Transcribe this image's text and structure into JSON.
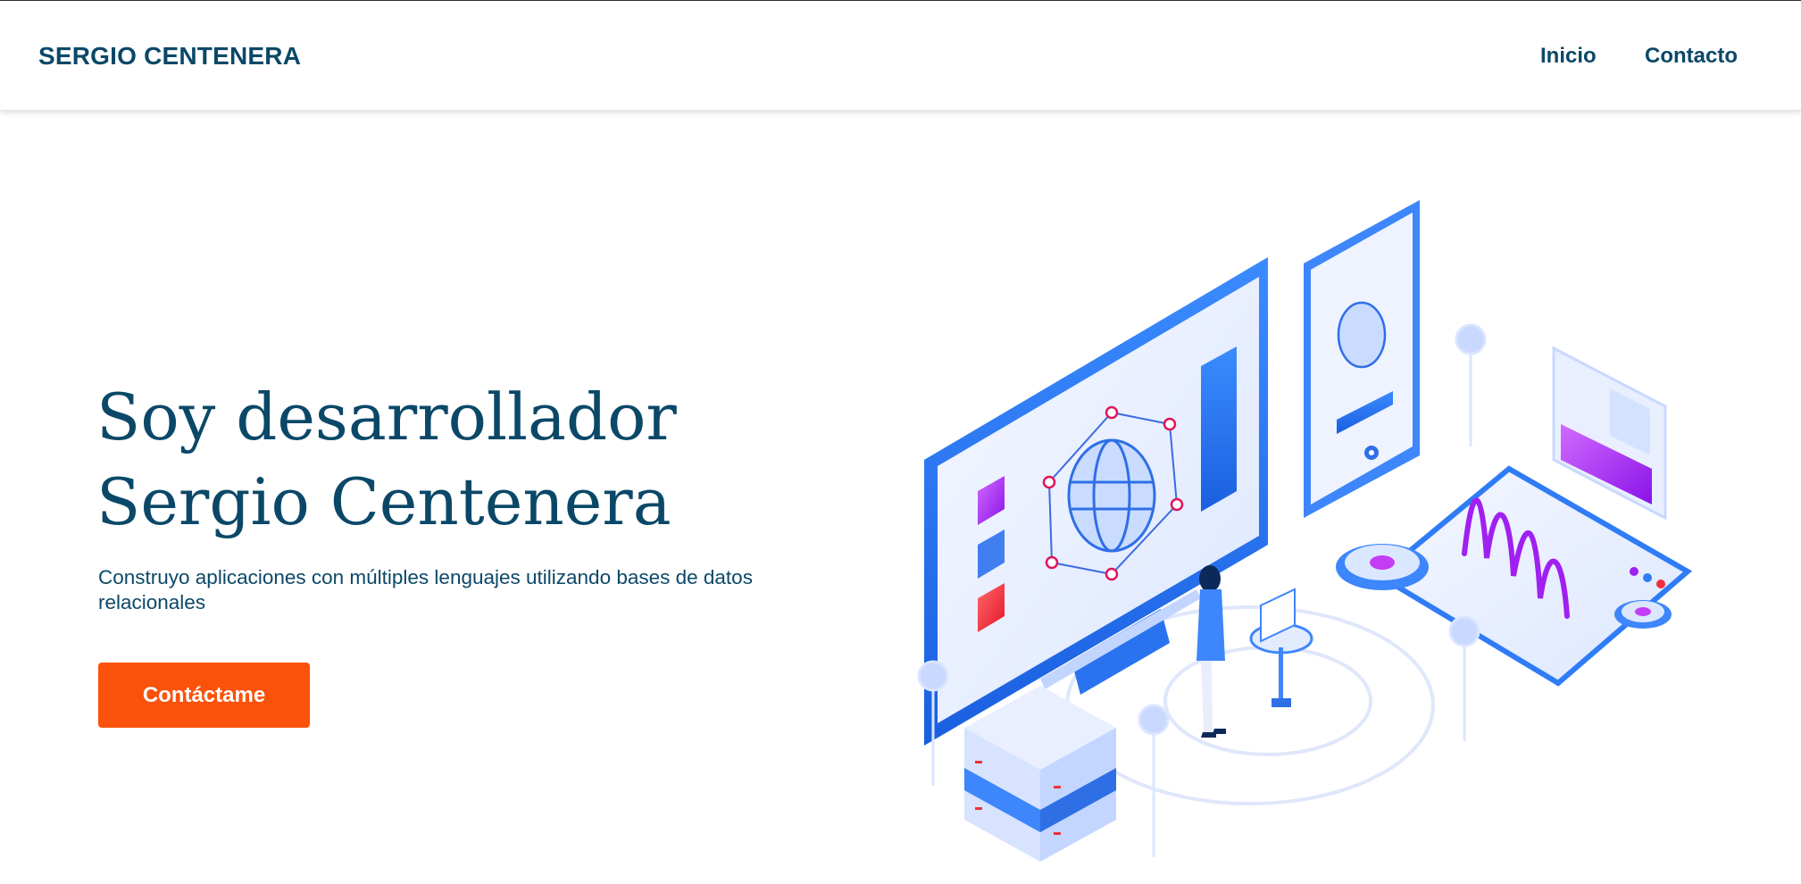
{
  "nav": {
    "brand": "SERGIO CENTENERA",
    "links": [
      {
        "label": "Inicio"
      },
      {
        "label": "Contacto"
      }
    ]
  },
  "hero": {
    "title_lines": [
      "Soy desarrollador",
      "Sergio Centenera"
    ],
    "description": "Construyo aplicaciones con múltiples lenguajes utilizando bases de datos relacionales",
    "cta_label": "Contáctame"
  },
  "colors": {
    "brand_text": "#0b4868",
    "cta": "#fa520a",
    "illustration_blue": "#2f7cf6",
    "illustration_light": "#e9efff",
    "accent_purple": "#a020f0",
    "accent_red": "#f0303a"
  }
}
